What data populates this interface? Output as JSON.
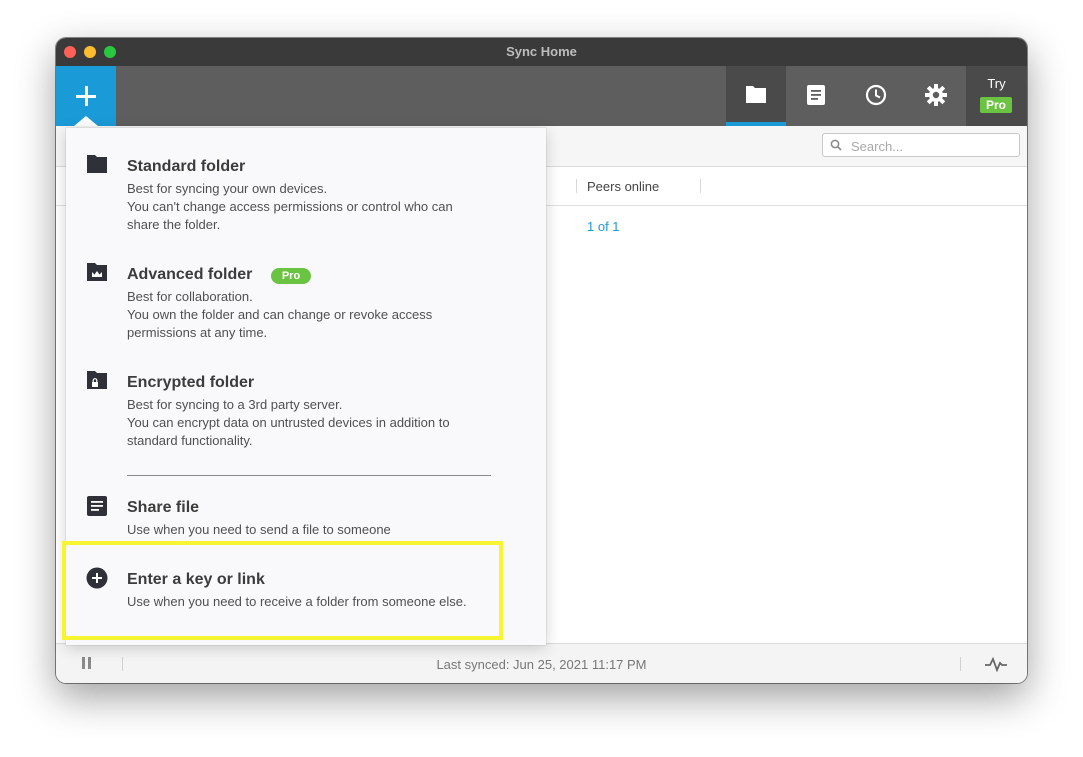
{
  "window": {
    "title": "Sync Home"
  },
  "toolbar": {
    "add_icon": "plus-icon",
    "tabs": [
      {
        "name": "folders",
        "icon": "folder-icon",
        "active": true
      },
      {
        "name": "files",
        "icon": "document-icon",
        "active": false
      },
      {
        "name": "history",
        "icon": "clock-icon",
        "active": false
      },
      {
        "name": "settings",
        "icon": "gear-icon",
        "active": false
      }
    ],
    "try_label": "Try",
    "pro_label": "Pro"
  },
  "search": {
    "placeholder": "Search..."
  },
  "table": {
    "columns": [
      "Peers online"
    ],
    "rows": [
      {
        "peers_online": "1 of 1"
      }
    ]
  },
  "menu": {
    "items": [
      {
        "title": "Standard folder",
        "icon": "folder-icon",
        "desc": [
          "Best for syncing your own devices.",
          "You can't change access permissions or control who can",
          "share the folder."
        ]
      },
      {
        "title": "Advanced folder",
        "icon": "folder-crown-icon",
        "badge": "Pro",
        "desc": [
          "Best for collaboration.",
          "You own the folder and can change or revoke access",
          "permissions at any time."
        ]
      },
      {
        "title": "Encrypted folder",
        "icon": "folder-lock-icon",
        "desc": [
          "Best for syncing to a 3rd party server.",
          "You can encrypt data on untrusted devices in addition to",
          "standard functionality."
        ]
      },
      {
        "title": "Share file",
        "icon": "document-icon",
        "desc": [
          "Use when you need to send a file to someone"
        ]
      },
      {
        "title": "Enter a key or link",
        "icon": "plus-circle-icon",
        "desc": [
          "Use when you need to receive a folder from someone else."
        ],
        "highlighted": true
      }
    ]
  },
  "footer": {
    "last_synced": "Last synced: Jun 25, 2021 11:17 PM"
  },
  "colors": {
    "accent": "#1a9bd7",
    "pro": "#6bc441",
    "highlight": "#f7f532",
    "toolbar": "#5e5e5e"
  }
}
